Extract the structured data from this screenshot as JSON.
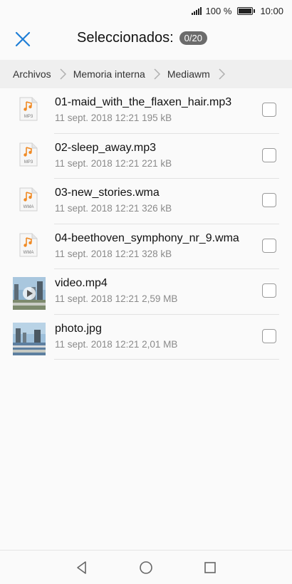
{
  "status": {
    "battery_text": "100 %",
    "time": "10:00"
  },
  "header": {
    "title": "Seleccionados:",
    "count": "0/20"
  },
  "breadcrumb": [
    "Archivos",
    "Memoria interna",
    "Mediawm"
  ],
  "files": [
    {
      "name": "01-maid_with_the_flaxen_hair.mp3",
      "meta": "11 sept. 2018 12:21 195 kB",
      "icon": "music-file-icon",
      "ext": "MP3"
    },
    {
      "name": "02-sleep_away.mp3",
      "meta": "11 sept. 2018 12:21 221 kB",
      "icon": "music-file-icon",
      "ext": "MP3"
    },
    {
      "name": "03-new_stories.wma",
      "meta": "11 sept. 2018 12:21 326 kB",
      "icon": "music-file-icon",
      "ext": "WMA"
    },
    {
      "name": "04-beethoven_symphony_nr_9.wma",
      "meta": "11 sept. 2018 12:21 328 kB",
      "icon": "music-file-icon",
      "ext": "WMA"
    },
    {
      "name": "video.mp4",
      "meta": "11 sept. 2018 12:21 2,59 MB",
      "icon": "video-thumbnail",
      "ext": ""
    },
    {
      "name": "photo.jpg",
      "meta": "11 sept. 2018 12:21 2,01 MB",
      "icon": "photo-thumbnail",
      "ext": ""
    }
  ],
  "colors": {
    "accent": "#1f7fd6",
    "music_icon": "#f08a24"
  }
}
